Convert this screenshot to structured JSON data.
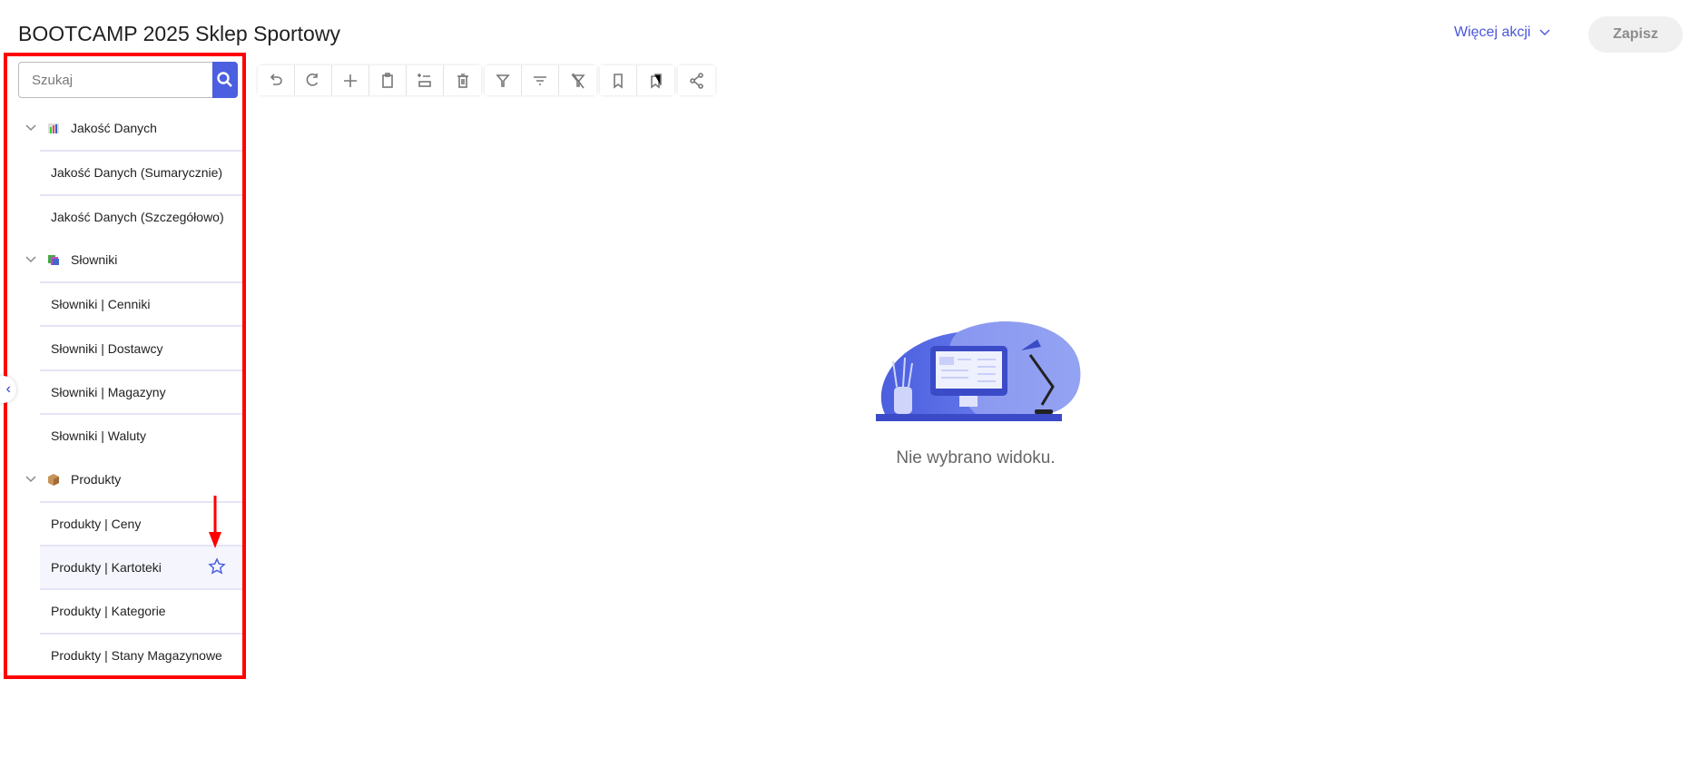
{
  "header": {
    "title": "BOOTCAMP 2025 Sklep Sportowy",
    "more_actions": "Więcej akcji",
    "save": "Zapisz"
  },
  "sidebar": {
    "search_placeholder": "Szukaj",
    "groups": [
      {
        "label": "Jakość Danych",
        "icon": "bar-chart-icon",
        "items": [
          "Jakość Danych (Sumarycznie)",
          "Jakość Danych (Szczegółowo)"
        ]
      },
      {
        "label": "Słowniki",
        "icon": "books-icon",
        "items": [
          "Słowniki | Cenniki",
          "Słowniki | Dostawcy",
          "Słowniki | Magazyny",
          "Słowniki | Waluty"
        ]
      },
      {
        "label": "Produkty",
        "icon": "package-icon",
        "items": [
          "Produkty | Ceny",
          "Produkty | Kartoteki",
          "Produkty | Kategorie",
          "Produkty | Stany Magazynowe"
        ]
      }
    ],
    "hovered_item": "Produkty | Kartoteki"
  },
  "toolbar": [
    "undo",
    "redo",
    "add",
    "paste",
    "insert-row",
    "delete",
    "filter",
    "sort-filter",
    "clear-filter",
    "bookmark",
    "bookmarks",
    "share"
  ],
  "main": {
    "empty_message": "Nie wybrano widoku."
  },
  "colors": {
    "accent": "#4b5fe0",
    "annotation": "#ff0000"
  }
}
